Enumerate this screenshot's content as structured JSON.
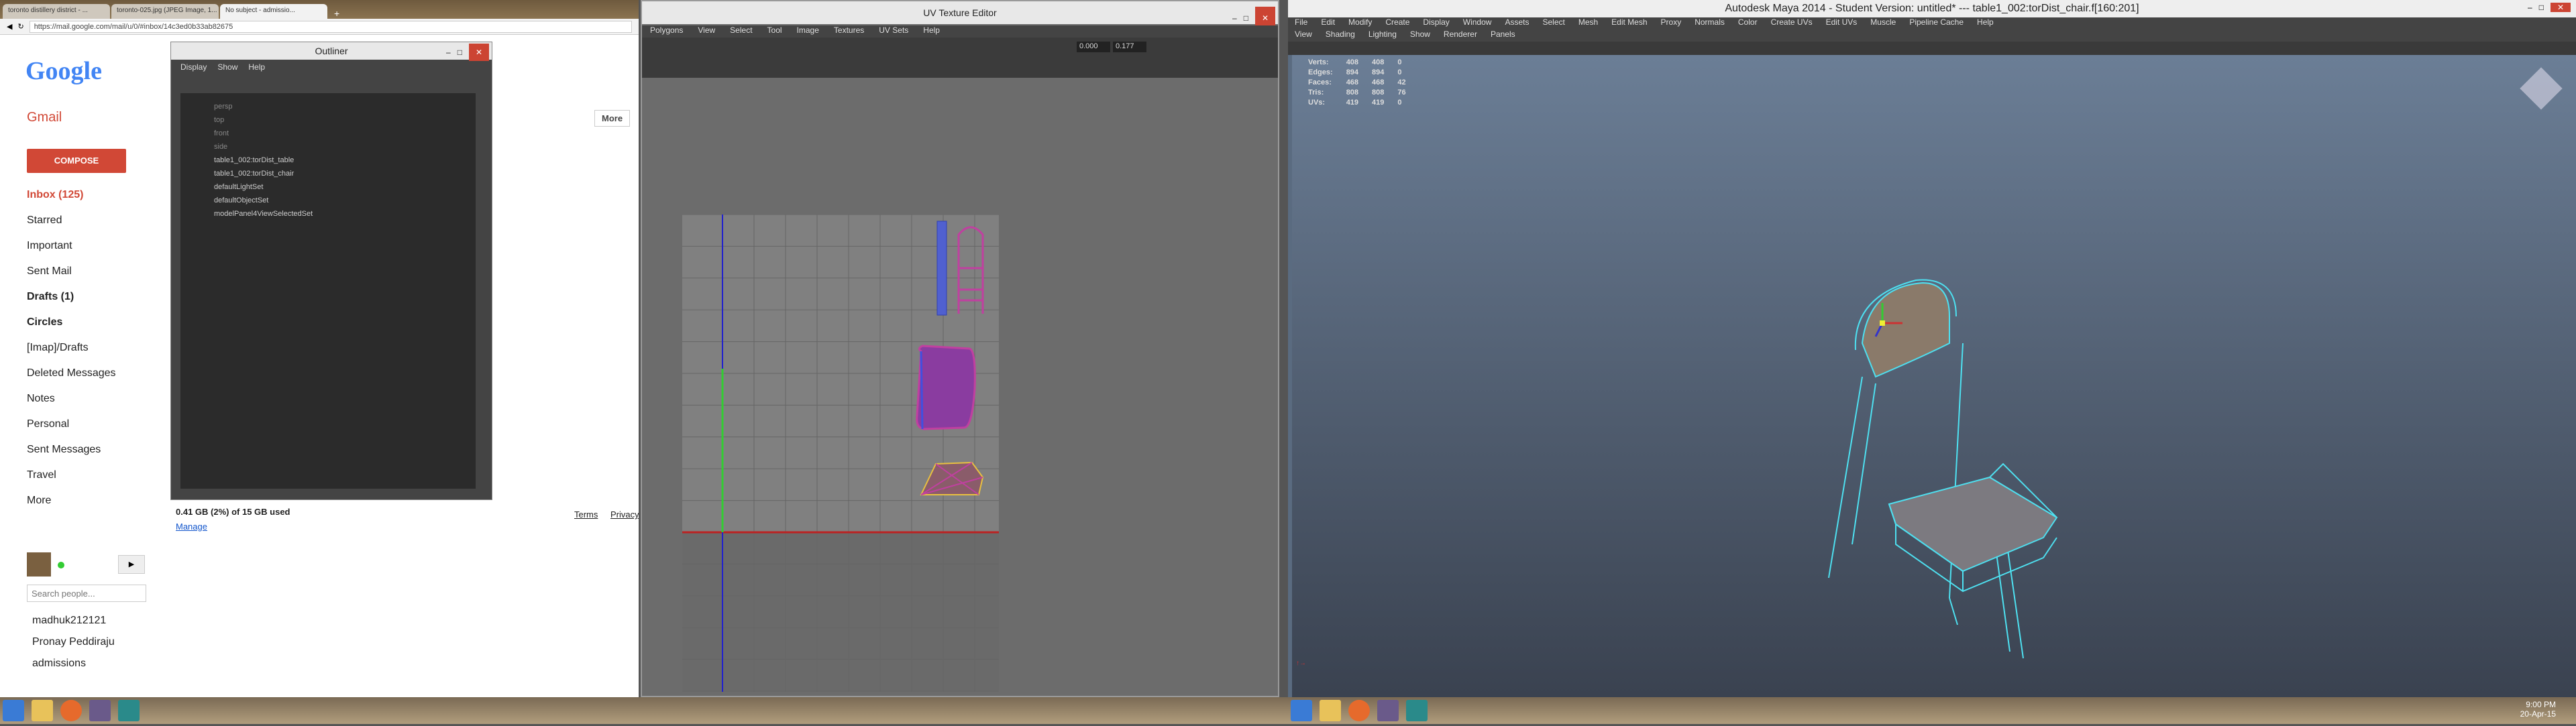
{
  "chrome": {
    "tabs": [
      "toronto distillery district - ...",
      "toronto-025.jpg (JPEG Image, 1...",
      "No subject - admissio..."
    ],
    "url": "https://mail.google.com/mail/u/0/#inbox/14c3ed0b33ab82675"
  },
  "gmail": {
    "logo": "Google",
    "app": "Gmail",
    "compose": "COMPOSE",
    "nav": [
      "Inbox (125)",
      "Starred",
      "Important",
      "Sent Mail",
      "Drafts (1)",
      "Circles",
      "[Imap]/Drafts",
      "Deleted Messages",
      "Notes",
      "Personal",
      "Sent Messages",
      "Travel",
      "More"
    ],
    "more_btn": "More",
    "storage": "0.41 GB (2%) of 15 GB used",
    "manage": "Manage",
    "footer_links": [
      "Terms",
      "Privacy"
    ],
    "search_people_placeholder": "Search people...",
    "contacts": [
      "madhuk212121",
      "Pronay Peddiraju",
      "admissions"
    ]
  },
  "outliner": {
    "title": "Outliner",
    "menu": [
      "Display",
      "Show",
      "Help"
    ],
    "items": [
      {
        "label": "persp",
        "dim": true
      },
      {
        "label": "top",
        "dim": true
      },
      {
        "label": "front",
        "dim": true
      },
      {
        "label": "side",
        "dim": true
      },
      {
        "label": "table1_002:torDist_table",
        "dim": false
      },
      {
        "label": "table1_002:torDist_chair",
        "dim": false
      },
      {
        "label": "defaultLightSet",
        "dim": false
      },
      {
        "label": "defaultObjectSet",
        "dim": false
      },
      {
        "label": "modelPanel4ViewSelectedSet",
        "dim": false
      }
    ]
  },
  "uv": {
    "title": "UV Texture Editor",
    "menu": [
      "Polygons",
      "View",
      "Select",
      "Tool",
      "Image",
      "Textures",
      "UV Sets",
      "Help"
    ],
    "field1": "0.000",
    "field2": "0.177"
  },
  "maya": {
    "title": "Autodesk Maya 2014 - Student Version: untitled*   ---   table1_002:torDist_chair.f[160:201]",
    "menu": [
      "File",
      "Edit",
      "Modify",
      "Create",
      "Display",
      "Window",
      "Assets",
      "Select",
      "Mesh",
      "Edit Mesh",
      "Proxy",
      "Normals",
      "Color",
      "Create UVs",
      "Edit UVs",
      "Muscle",
      "Pipeline Cache",
      "Help"
    ],
    "panel_menu": [
      "View",
      "Shading",
      "Lighting",
      "Show",
      "Renderer",
      "Panels"
    ],
    "hud": [
      {
        "label": "Verts:",
        "a": "408",
        "b": "408",
        "c": "0"
      },
      {
        "label": "Edges:",
        "a": "894",
        "b": "894",
        "c": "0"
      },
      {
        "label": "Faces:",
        "a": "468",
        "b": "468",
        "c": "42"
      },
      {
        "label": "Tris:",
        "a": "808",
        "b": "808",
        "c": "76"
      },
      {
        "label": "UVs:",
        "a": "419",
        "b": "419",
        "c": "0"
      }
    ],
    "time": "9:00 PM",
    "date": "20-Apr-15"
  },
  "colors": {
    "gmail_red": "#d14836",
    "uv_pink": "#c040a0",
    "uv_blue": "#3050d0",
    "chair_cyan": "#4ee0f0"
  }
}
